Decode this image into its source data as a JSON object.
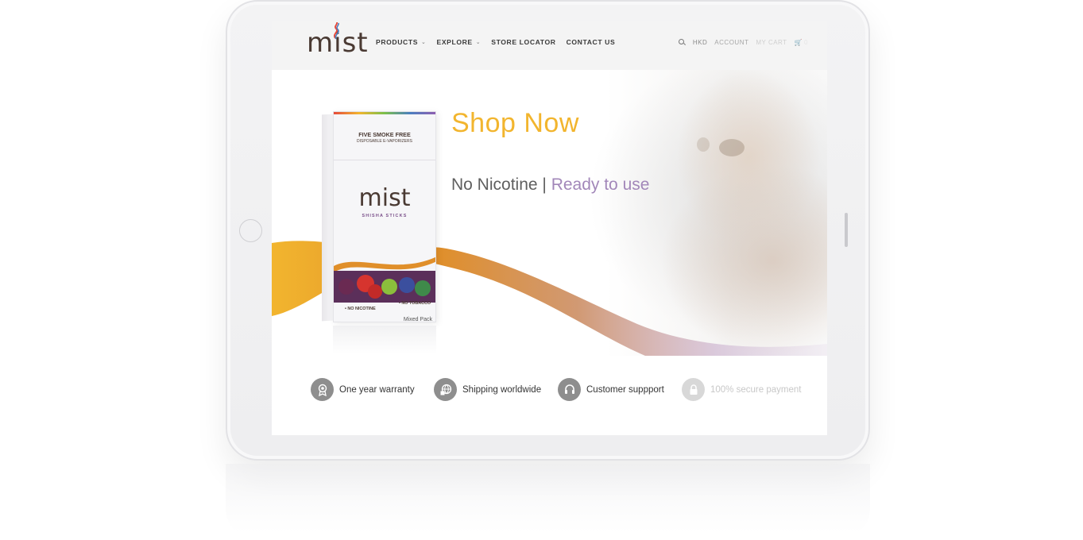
{
  "brand": {
    "logo_text": "mist",
    "accent_color": "#f2b52e",
    "purple_color": "#a287b9"
  },
  "nav": {
    "items": [
      {
        "label": "PRODUCTS",
        "has_dropdown": true
      },
      {
        "label": "EXPLORE",
        "has_dropdown": true
      },
      {
        "label": "STORE LOCATOR",
        "has_dropdown": false
      },
      {
        "label": "CONTACT US",
        "has_dropdown": false
      }
    ],
    "right": {
      "search_icon": "search-icon",
      "currency": "HKD",
      "account": "ACCOUNT",
      "cart": "MY CART",
      "cart_count": "0"
    }
  },
  "hero": {
    "headline": "Shop Now",
    "tagline_main": "No Nicotine",
    "tagline_separator": " | ",
    "tagline_accent": "Ready to use"
  },
  "product_pack": {
    "line1": "FIVE SMOKE FREE",
    "line2": "DISPOSABLE E-VAPORIZERS",
    "logo": "mist",
    "subtitle": "SHISHA STICKS",
    "badge_left": "• NO NICOTINE",
    "badge_right": "• NO TOBACCO",
    "variant": "Mixed Pack"
  },
  "features": [
    {
      "icon": "award-ribbon-icon",
      "label": "One year warranty"
    },
    {
      "icon": "globe-box-icon",
      "label": "Shipping worldwide"
    },
    {
      "icon": "headset-icon",
      "label": "Customer suppport"
    },
    {
      "icon": "padlock-icon",
      "label": "100% secure payment"
    }
  ]
}
